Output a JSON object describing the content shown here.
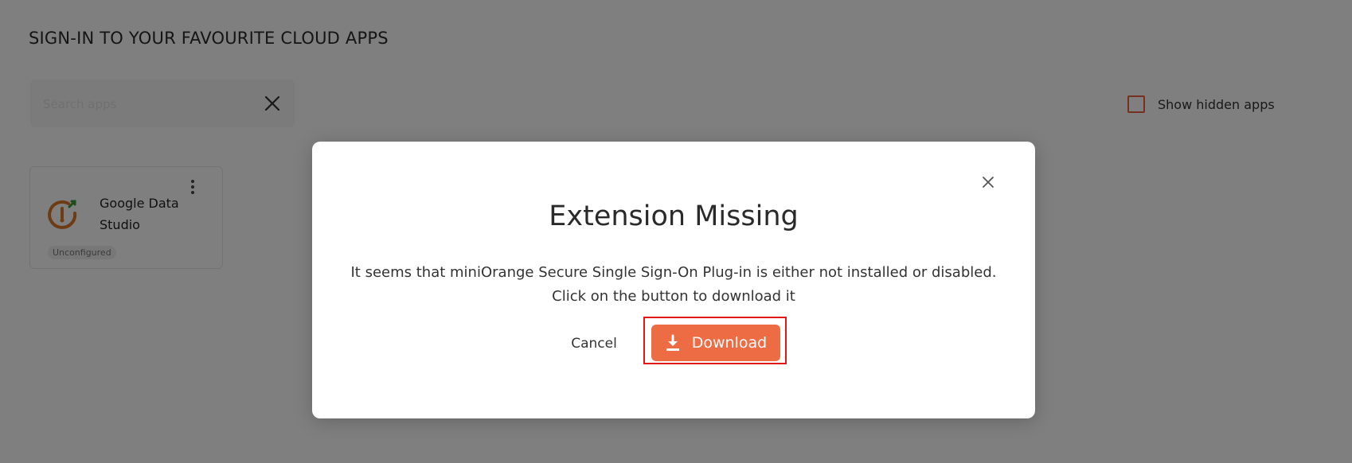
{
  "page": {
    "title": "SIGN-IN TO YOUR FAVOURITE CLOUD APPS",
    "search": {
      "placeholder": "Search apps",
      "value": ""
    },
    "show_hidden_apps_label": "Show hidden apps",
    "apps": [
      {
        "name": "Google Data Studio",
        "status": "Unconfigured"
      }
    ]
  },
  "modal": {
    "title": "Extension Missing",
    "message_line1": "It seems that miniOrange Secure Single Sign-On Plug-in is either not installed or disabled.",
    "message_line2": "Click on the button to download it",
    "cancel_label": "Cancel",
    "download_label": "Download"
  },
  "colors": {
    "accent": "#ee6c44",
    "checkbox_border": "#e8623e",
    "highlight": "#e01818",
    "overlay": "rgba(0,0,0,0.5)"
  },
  "icons": {
    "search_clear": "close-icon",
    "modal_close": "close-icon",
    "download": "download-icon",
    "app_menu": "kebab-menu-icon",
    "app_logo": "app-logo-icon"
  }
}
